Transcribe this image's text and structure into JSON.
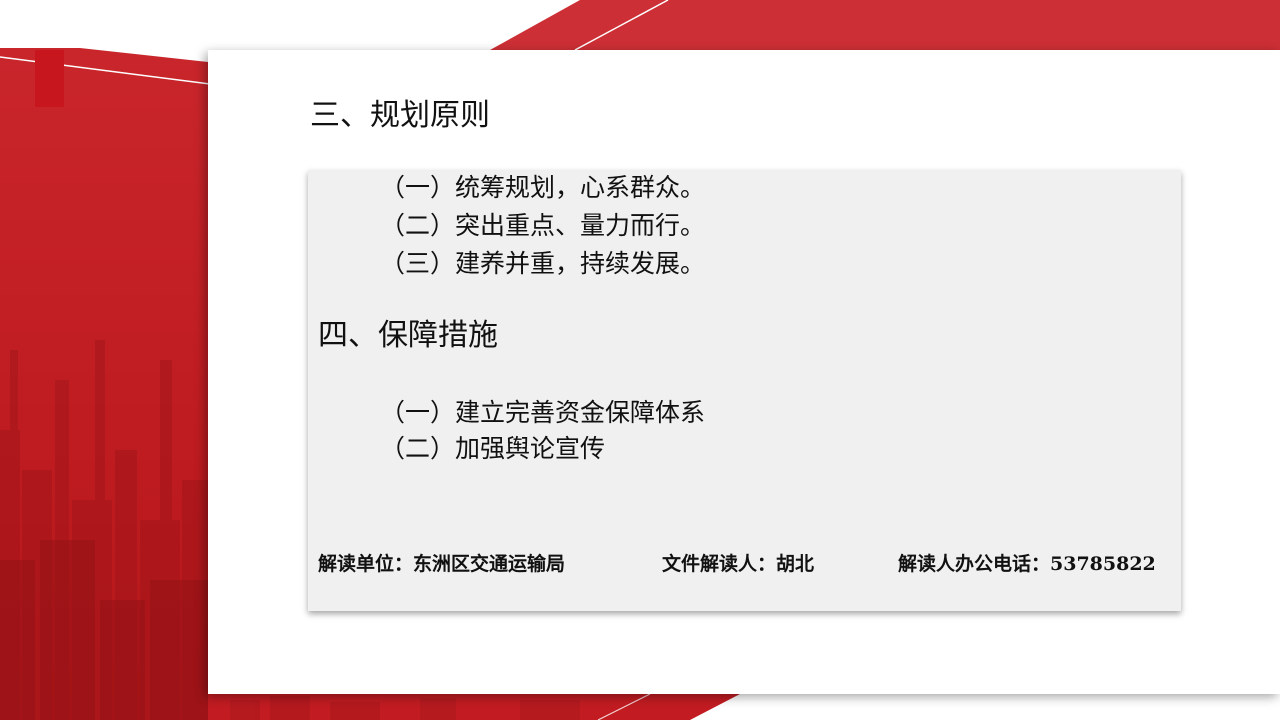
{
  "section3": {
    "title": "三、规划原则",
    "items": [
      "（一）统筹规划，心系群众。",
      "（二）突出重点、量力而行。",
      "（三）建养并重，持续发展。"
    ]
  },
  "section4": {
    "title": "四、保障措施",
    "items": [
      "（一）建立完善资金保障体系",
      "（二）加强舆论宣传"
    ]
  },
  "footer": {
    "unit": "解读单位：东洲区交通运输局",
    "reader": "文件解读人：胡北",
    "phone": "解读人办公电话：53785822"
  },
  "colors": {
    "accent_red": "#c8161e",
    "card_bg": "#f0f0f0"
  }
}
